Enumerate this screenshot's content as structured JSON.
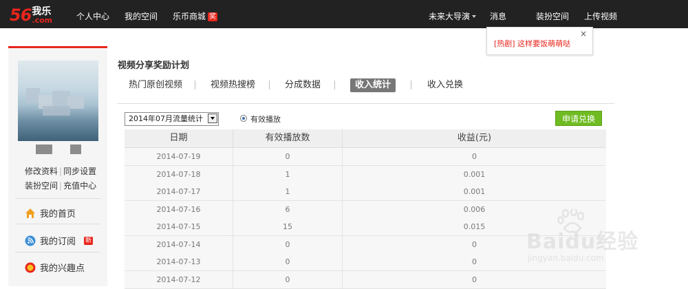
{
  "logo": {
    "number": "56",
    "cn": "我乐",
    "domain": ".com"
  },
  "top_nav": {
    "left": [
      "个人中心",
      "我的空间"
    ],
    "shop": {
      "label": "乐币商城",
      "badge": "奖"
    },
    "right": [
      {
        "label": "未来大导演",
        "dropdown": true
      },
      {
        "label": "消息"
      },
      {
        "label": "装扮空间"
      },
      {
        "label": "上传视频"
      }
    ]
  },
  "popup": {
    "text": "[热剧] 这样要饭萌萌哒",
    "close": "×"
  },
  "sidebar": {
    "links_row1": [
      "修改资料",
      "同步设置"
    ],
    "links_row2": [
      "装扮空间",
      "充值中心"
    ],
    "items": [
      {
        "label": "我的首页",
        "icon": "home-icon"
      },
      {
        "label": "我的订阅",
        "icon": "rss-icon",
        "badge": "新"
      },
      {
        "label": "我的兴趣点",
        "icon": "interest-icon"
      }
    ]
  },
  "page_title": "视频分享奖励计划",
  "tabs": [
    "热门原创视频",
    "视频热搜榜",
    "分成数据",
    "收入统计",
    "收入兑换"
  ],
  "active_tab": 3,
  "controls": {
    "period_select": "2014年07月流量统计",
    "radio_label": "有效播放",
    "apply_button": "申请兑换"
  },
  "table": {
    "headers": [
      "日期",
      "有效播放数",
      "收益(元)"
    ],
    "rows": [
      [
        "2014-07-19",
        "0",
        "0"
      ],
      [
        "2014-07-18",
        "1",
        "0.001"
      ],
      [
        "2014-07-17",
        "1",
        "0.001"
      ],
      [
        "2014-07-16",
        "6",
        "0.006"
      ],
      [
        "2014-07-15",
        "15",
        "0.015"
      ],
      [
        "2014-07-14",
        "0",
        "0"
      ],
      [
        "2014-07-13",
        "0",
        "0"
      ],
      [
        "2014-07-12",
        "0",
        "0"
      ]
    ]
  },
  "watermark": {
    "brand": "Baidu经验",
    "url": "jingyan.baidu.com"
  },
  "colors": {
    "accent": "#e8261c",
    "topbar": "#222222",
    "button_green": "#6fbb22",
    "active_tab": "#777777"
  }
}
